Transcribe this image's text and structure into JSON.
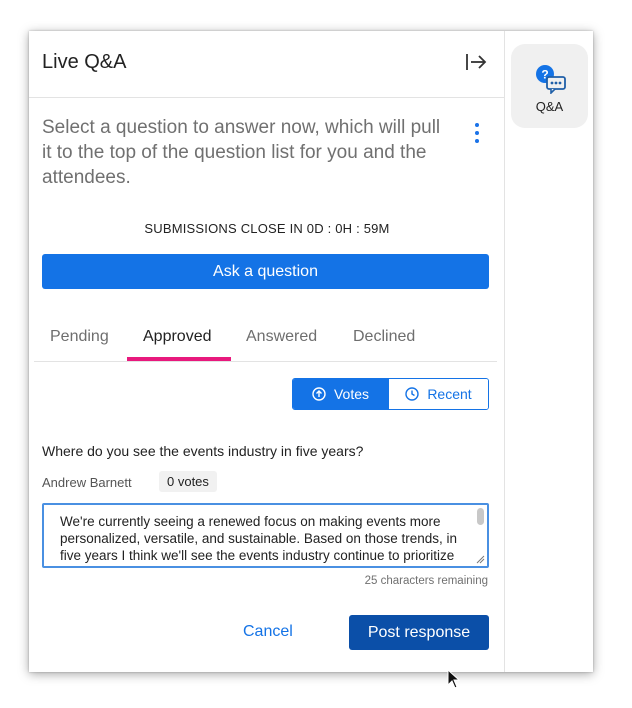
{
  "header": {
    "title": "Live Q&A",
    "collapse_icon": "collapse-panel-icon"
  },
  "instructions": "Select a question to answer now, which will pull it to the top of the question list for you and the attendees.",
  "countdown": "SUBMISSIONS CLOSE IN 0D : 0H : 59M",
  "ask_button": "Ask a question",
  "tabs": [
    {
      "label": "Pending",
      "active": false
    },
    {
      "label": "Approved",
      "active": true
    },
    {
      "label": "Answered",
      "active": false
    },
    {
      "label": "Declined",
      "active": false
    }
  ],
  "sort": {
    "votes_label": "Votes",
    "recent_label": "Recent",
    "selected": "Votes"
  },
  "question": {
    "text": "Where do you see the events industry in five years?",
    "author": "Andrew Barnett",
    "votes": "0 votes"
  },
  "response": {
    "value": "We're currently seeing a renewed focus on making events more personalized, versatile, and sustainable. Based on those trends, in five years I think we'll see the events industry continue to prioritize these elements.",
    "chars_remaining": "25 characters remaining"
  },
  "actions": {
    "cancel": "Cancel",
    "post": "Post response"
  },
  "rail": {
    "qa_label": "Q&A",
    "qa_icon": "qa-chat-icon"
  },
  "colors": {
    "accent": "#1473e6",
    "tab_underline": "#e8197d",
    "post_button": "#0b4fa8"
  }
}
